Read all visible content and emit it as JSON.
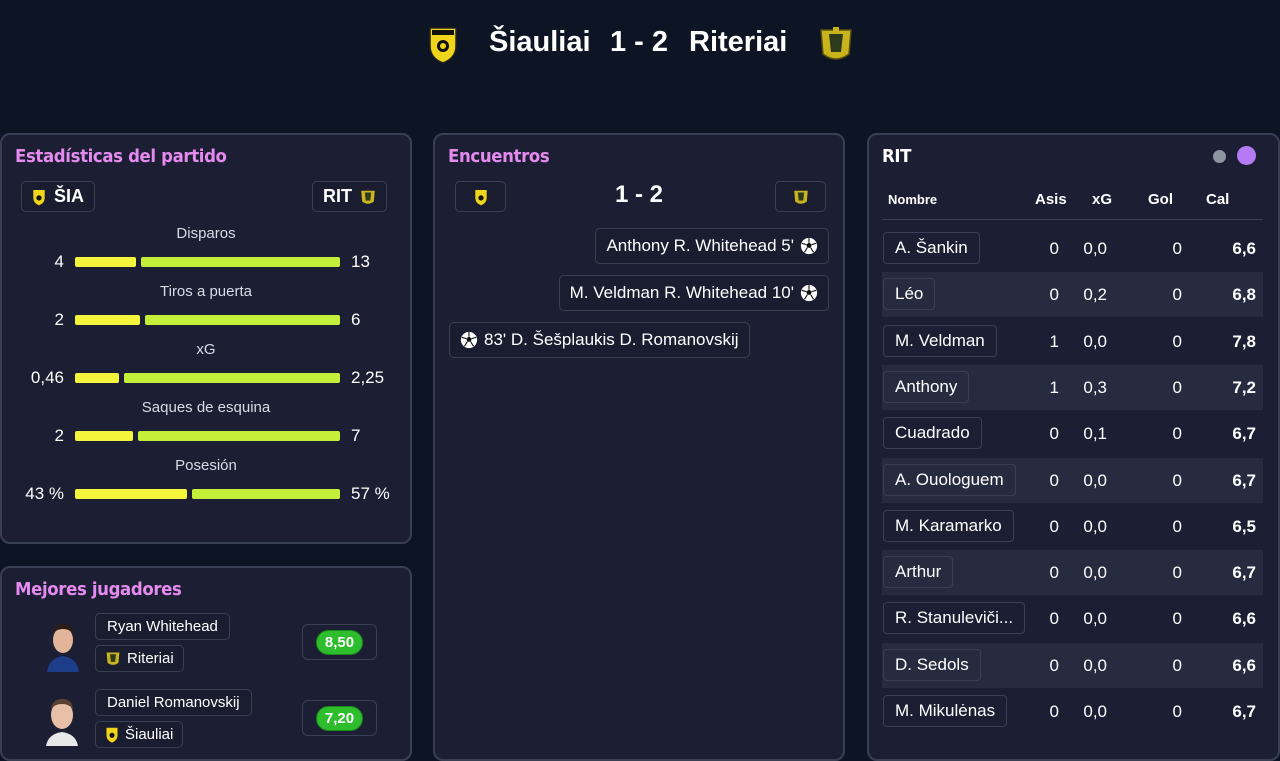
{
  "match": {
    "home_team": "Šiauliai",
    "score": "1 - 2",
    "away_team": "Riteriai"
  },
  "stats_panel": {
    "title": "Estadísticas del partido",
    "home_abbr": "ŠIA",
    "away_abbr": "RIT",
    "stats": [
      {
        "label": "Disparos",
        "home": "4",
        "away": "13",
        "home_share": 0.235
      },
      {
        "label": "Tiros a puerta",
        "home": "2",
        "away": "6",
        "home_share": 0.25
      },
      {
        "label": "xG",
        "home": "0,46",
        "away": "2,25",
        "home_share": 0.17
      },
      {
        "label": "Saques de esquina",
        "home": "2",
        "away": "7",
        "home_share": 0.222
      },
      {
        "label": "Posesión",
        "home": "43 %",
        "away": "57 %",
        "home_share": 0.43
      }
    ]
  },
  "best_players": {
    "title": "Mejores jugadores",
    "players": [
      {
        "name": "Ryan Whitehead",
        "team": "Riteriai",
        "rating": "8,50"
      },
      {
        "name": "Daniel Romanovskij",
        "team": "Šiauliai",
        "rating": "7,20"
      }
    ]
  },
  "events_panel": {
    "title": "Encuentros",
    "score": "1 - 2",
    "events": [
      {
        "text": "Anthony R. Whitehead 5'",
        "side": "away"
      },
      {
        "text": "M. Veldman R. Whitehead 10'",
        "side": "away"
      },
      {
        "text": "83' D. Šešplaukis D. Romanovskij",
        "side": "home"
      }
    ]
  },
  "lineup_panel": {
    "title": "RIT",
    "columns": [
      "Nombre",
      "Asis",
      "xG",
      "Gol",
      "Cal"
    ],
    "rows": [
      {
        "name": "A. Šankin",
        "asis": "0",
        "xg": "0,0",
        "gol": "0",
        "cal": "6,6"
      },
      {
        "name": "Léo",
        "asis": "0",
        "xg": "0,2",
        "gol": "0",
        "cal": "6,8"
      },
      {
        "name": "M. Veldman",
        "asis": "1",
        "xg": "0,0",
        "gol": "0",
        "cal": "7,8"
      },
      {
        "name": "Anthony",
        "asis": "1",
        "xg": "0,3",
        "gol": "0",
        "cal": "7,2"
      },
      {
        "name": "Cuadrado",
        "asis": "0",
        "xg": "0,1",
        "gol": "0",
        "cal": "6,7"
      },
      {
        "name": "A. Ouologuem",
        "asis": "0",
        "xg": "0,0",
        "gol": "0",
        "cal": "6,7"
      },
      {
        "name": "M. Karamarko",
        "asis": "0",
        "xg": "0,0",
        "gol": "0",
        "cal": "6,5"
      },
      {
        "name": "Arthur",
        "asis": "0",
        "xg": "0,0",
        "gol": "0",
        "cal": "6,7"
      },
      {
        "name": "R. Stanuleviči...",
        "asis": "0",
        "xg": "0,0",
        "gol": "0",
        "cal": "6,6"
      },
      {
        "name": "D. Sedols",
        "asis": "0",
        "xg": "0,0",
        "gol": "0",
        "cal": "6,6"
      },
      {
        "name": "M. Mikulėnas",
        "asis": "0",
        "xg": "0,0",
        "gol": "0",
        "cal": "6,7"
      }
    ]
  },
  "colors": {
    "background": "#0d1525",
    "panel": "#1c1f33",
    "accent_title": "#e58bf0",
    "home_bar": "#f5f53b",
    "away_bar": "#c4f03a",
    "rating_badge": "#2dbd2d",
    "dot_inactive": "#8c95a0",
    "dot_active": "#b57bf5"
  },
  "icons": {
    "home_crest": "siauliai-crest-icon",
    "away_crest": "riteriai-crest-icon",
    "goal": "soccer-ball-icon"
  }
}
